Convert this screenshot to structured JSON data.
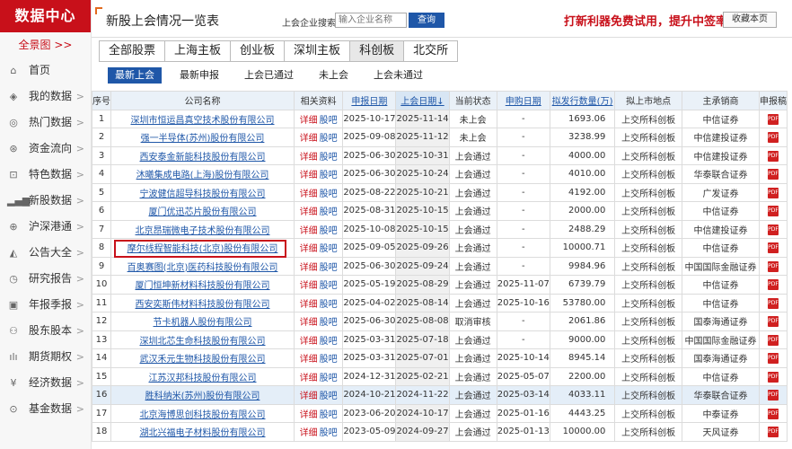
{
  "sidebar": {
    "logo": "数据中心",
    "quanjing": "全景图 >>",
    "items": [
      {
        "label": "首页",
        "icon": "home-icon",
        "glyph": "⌂",
        "arrow": ""
      },
      {
        "label": "我的数据",
        "icon": "layers-icon",
        "glyph": "◈",
        "arrow": ">"
      },
      {
        "label": "热门数据",
        "icon": "target-icon",
        "glyph": "◎",
        "arrow": ">"
      },
      {
        "label": "资金流向",
        "icon": "money-icon",
        "glyph": "⊛",
        "arrow": ">"
      },
      {
        "label": "特色数据",
        "icon": "bookmark-icon",
        "glyph": "⊡",
        "arrow": ">"
      },
      {
        "label": "新股数据",
        "icon": "bar-chart-icon",
        "glyph": "▂▄▆",
        "arrow": ">"
      },
      {
        "label": "沪深港通",
        "icon": "exchange-icon",
        "glyph": "⊕",
        "arrow": ">"
      },
      {
        "label": "公告大全",
        "icon": "megaphone-icon",
        "glyph": "◭",
        "arrow": ">"
      },
      {
        "label": "研究报告",
        "icon": "clock-icon",
        "glyph": "◷",
        "arrow": ">"
      },
      {
        "label": "年报季报",
        "icon": "report-icon",
        "glyph": "▣",
        "arrow": ">"
      },
      {
        "label": "股东股本",
        "icon": "user-icon",
        "glyph": "⚇",
        "arrow": ">"
      },
      {
        "label": "期货期权",
        "icon": "candlestick-icon",
        "glyph": "ılı",
        "arrow": ">"
      },
      {
        "label": "经济数据",
        "icon": "yuan-icon",
        "glyph": "¥",
        "arrow": ">"
      },
      {
        "label": "基金数据",
        "icon": "fund-icon",
        "glyph": "⊙",
        "arrow": ">"
      }
    ]
  },
  "header": {
    "title": "新股上会情况一览表",
    "search_label": "上会企业搜索:",
    "search_placeholder": "输入企业名称",
    "search_button": "查询",
    "promo": "打新利器免费试用，提升中签率",
    "favorite": "收藏本页"
  },
  "tabs": [
    "全部股票",
    "上海主板",
    "创业板",
    "深圳主板",
    "科创板",
    "北交所"
  ],
  "active_tab": 4,
  "subtabs": [
    "最新上会",
    "最新申报",
    "上会已通过",
    "未上会",
    "上会未通过"
  ],
  "active_subtab": 0,
  "table": {
    "headers": [
      "序号",
      "公司名称",
      "相关资料",
      "申报日期",
      "上会日期↓",
      "当前状态",
      "申购日期",
      "拟发行数量(万)",
      "拟上市地点",
      "主承销商",
      "申报稿"
    ],
    "material_links": [
      "详细",
      "股吧"
    ],
    "pdf_label": "PDF",
    "rows": [
      [
        "1",
        "深圳市恒运昌真空技术股份有限公司",
        "2025-10-17",
        "2025-11-14",
        "未上会",
        "-",
        "1693.06",
        "上交所科创板",
        "中信证券"
      ],
      [
        "2",
        "强一半导体(苏州)股份有限公司",
        "2025-09-08",
        "2025-11-12",
        "未上会",
        "-",
        "3238.99",
        "上交所科创板",
        "中信建投证券"
      ],
      [
        "3",
        "西安泰金新能科技股份有限公司",
        "2025-06-30",
        "2025-10-31",
        "上会通过",
        "-",
        "4000.00",
        "上交所科创板",
        "中信建投证券"
      ],
      [
        "4",
        "沐曦集成电路(上海)股份有限公司",
        "2025-06-30",
        "2025-10-24",
        "上会通过",
        "-",
        "4010.00",
        "上交所科创板",
        "华泰联合证券"
      ],
      [
        "5",
        "宁波健信超导科技股份有限公司",
        "2025-08-22",
        "2025-10-21",
        "上会通过",
        "-",
        "4192.00",
        "上交所科创板",
        "广发证券"
      ],
      [
        "6",
        "厦门优迅芯片股份有限公司",
        "2025-08-31",
        "2025-10-15",
        "上会通过",
        "-",
        "2000.00",
        "上交所科创板",
        "中信证券"
      ],
      [
        "7",
        "北京昂瑞微电子技术股份有限公司",
        "2025-10-08",
        "2025-10-15",
        "上会通过",
        "-",
        "2488.29",
        "上交所科创板",
        "中信建投证券"
      ],
      [
        "8",
        "摩尔线程智能科技(北京)股份有限公司",
        "2025-09-05",
        "2025-09-26",
        "上会通过",
        "-",
        "10000.71",
        "上交所科创板",
        "中信证券"
      ],
      [
        "9",
        "百奥赛图(北京)医药科技股份有限公司",
        "2025-06-30",
        "2025-09-24",
        "上会通过",
        "-",
        "9984.96",
        "上交所科创板",
        "中国国际金融证券"
      ],
      [
        "10",
        "厦门恒坤新材料科技股份有限公司",
        "2025-05-19",
        "2025-08-29",
        "上会通过",
        "2025-11-07",
        "6739.79",
        "上交所科创板",
        "中信证券"
      ],
      [
        "11",
        "西安奕斯伟材料科技股份有限公司",
        "2025-04-02",
        "2025-08-14",
        "上会通过",
        "2025-10-16",
        "53780.00",
        "上交所科创板",
        "中信证券"
      ],
      [
        "12",
        "节卡机器人股份有限公司",
        "2025-06-30",
        "2025-08-08",
        "取消审核",
        "-",
        "2061.86",
        "上交所科创板",
        "国泰海通证券"
      ],
      [
        "13",
        "深圳北芯生命科技股份有限公司",
        "2025-03-31",
        "2025-07-18",
        "上会通过",
        "-",
        "9000.00",
        "上交所科创板",
        "中国国际金融证券"
      ],
      [
        "14",
        "武汉禾元生物科技股份有限公司",
        "2025-03-31",
        "2025-07-01",
        "上会通过",
        "2025-10-14",
        "8945.14",
        "上交所科创板",
        "国泰海通证券"
      ],
      [
        "15",
        "江苏汉邦科技股份有限公司",
        "2024-12-31",
        "2025-02-21",
        "上会通过",
        "2025-05-07",
        "2200.00",
        "上交所科创板",
        "中信证券"
      ],
      [
        "16",
        "胜科纳米(苏州)股份有限公司",
        "2024-10-21",
        "2024-11-22",
        "上会通过",
        "2025-03-14",
        "4033.11",
        "上交所科创板",
        "华泰联合证券"
      ],
      [
        "17",
        "北京海博思创科技股份有限公司",
        "2023-06-20",
        "2024-10-17",
        "上会通过",
        "2025-01-16",
        "4443.25",
        "上交所科创板",
        "中泰证券"
      ],
      [
        "18",
        "湖北兴福电子材料股份有限公司",
        "2023-05-09",
        "2024-09-27",
        "上会通过",
        "2025-01-13",
        "10000.00",
        "上交所科创板",
        "天风证券"
      ]
    ]
  },
  "highlight_row_index": 15,
  "boxed_row_index": 7,
  "colors": {
    "brand_red": "#c8101a",
    "link_blue": "#1f57a8",
    "header_bg": "#eaf1f8",
    "highlight_row": "#e4eef8"
  }
}
